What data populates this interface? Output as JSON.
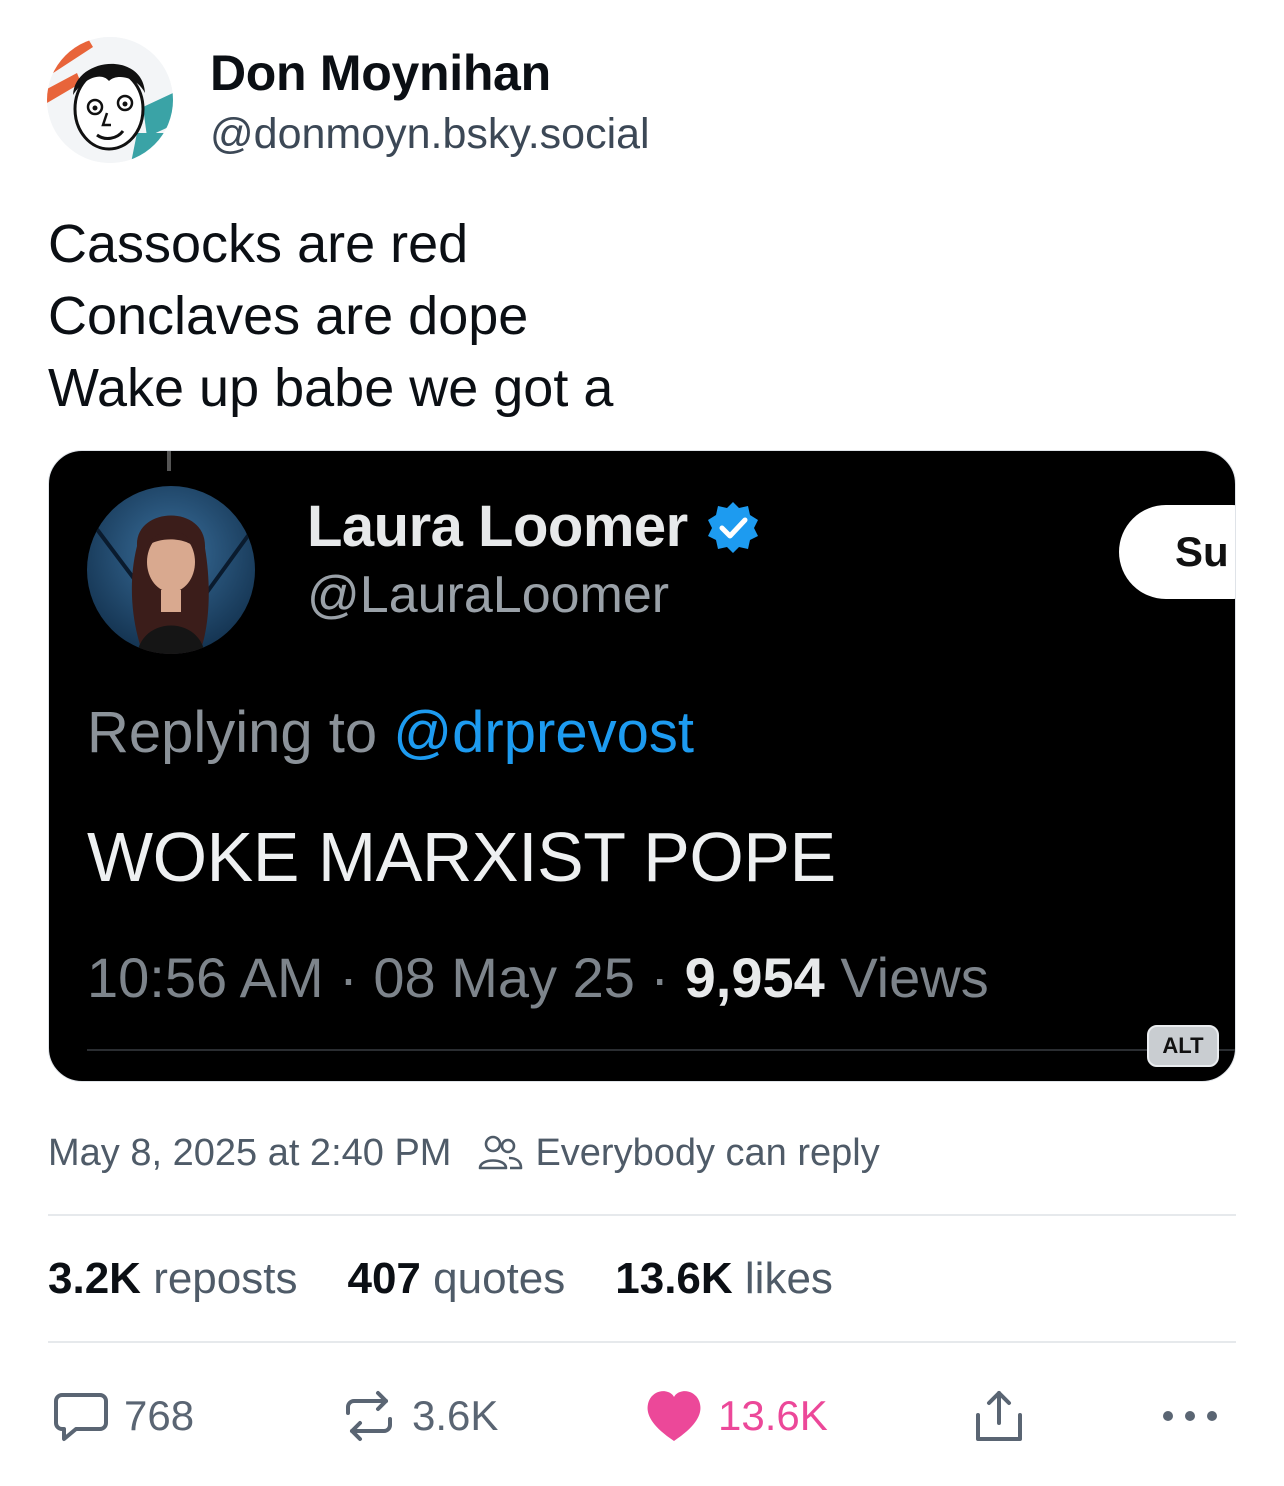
{
  "author": {
    "name": "Don Moynihan",
    "handle": "@donmoyn.bsky.social"
  },
  "post": {
    "lines": [
      "Cassocks are red",
      "Conclaves are dope",
      "Wake up babe we got a"
    ]
  },
  "embed": {
    "name": "Laura Loomer",
    "handle": "@LauraLoomer",
    "follow_label_partial": "Su",
    "reply_prefix": "Replying to ",
    "reply_mention": "@drprevost",
    "text": "WOKE MARXIST POPE",
    "meta_prefix": "10:56 AM · 08 May 25 · ",
    "views_count": "9,954",
    "views_label": " Views",
    "alt_badge": "ALT"
  },
  "timestamp": {
    "date": "May 8, 2025 at 2:40 PM",
    "reply_setting": "Everybody can reply"
  },
  "stats": {
    "reposts_count": "3.2K",
    "reposts_label": "reposts",
    "quotes_count": "407",
    "quotes_label": "quotes",
    "likes_count": "13.6K",
    "likes_label": "likes"
  },
  "actions": {
    "replies": "768",
    "reposts": "3.6K",
    "likes": "13.6K"
  },
  "colors": {
    "like_pink": "#ec4899",
    "link_blue": "#1d9bf0",
    "muted": "#4f5b68"
  }
}
